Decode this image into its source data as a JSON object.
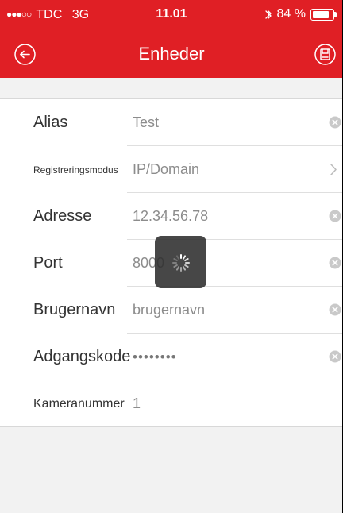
{
  "status": {
    "signal_dots": "●●●○○",
    "carrier": "TDC",
    "network": "3G",
    "time": "11.01",
    "battery_percent_text": "84 %",
    "battery_level": 0.84
  },
  "nav": {
    "title": "Enheder",
    "back_icon": "back-circle-icon",
    "save_icon": "save-icon"
  },
  "form": {
    "rows": [
      {
        "label": "Alias",
        "value": "Test",
        "trailing_icon": "clear-icon"
      },
      {
        "label": "Registreringsmodus",
        "value": "IP/Domain",
        "trailing_icon": "chevron-right-icon"
      },
      {
        "label": "Adresse",
        "value": "12.34.56.78",
        "trailing_icon": "clear-icon"
      },
      {
        "label": "Port",
        "value": "8000",
        "trailing_icon": "clear-icon"
      },
      {
        "label": "Brugernavn",
        "value": "brugernavn",
        "trailing_icon": "clear-icon"
      },
      {
        "label": "Adgangskode",
        "value": "••••••••",
        "trailing_icon": "clear-icon"
      },
      {
        "label": "Kameranummer",
        "value": "1",
        "trailing_icon": ""
      }
    ]
  },
  "loading": {
    "icon": "loading-spinner-icon"
  },
  "colors": {
    "brand": "#e01f25",
    "background": "#f2f2f2",
    "surface": "#ffffff",
    "label": "#333333",
    "value": "#8c8c8c"
  }
}
